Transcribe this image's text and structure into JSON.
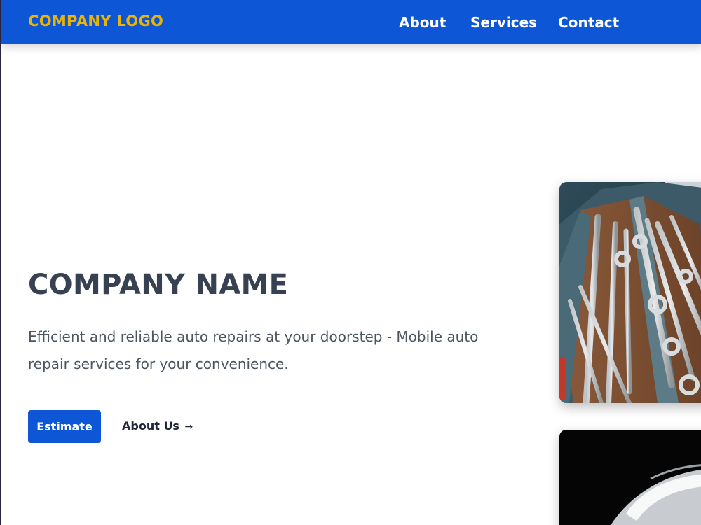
{
  "header": {
    "logo_text": "COMPANY LOGO",
    "nav": {
      "about": "About",
      "services": "Services",
      "contact": "Contact"
    }
  },
  "hero": {
    "title": "COMPANY NAME",
    "subtitle": "Efficient and reliable auto repairs at your doorstep - Mobile auto repair services for your convenience.",
    "primary_button": "Estimate",
    "secondary_link": "About Us",
    "secondary_link_arrow": "→"
  },
  "images": {
    "tools": "tool drawer with wrenches",
    "car": "car in the dark"
  },
  "colors": {
    "brand_blue": "#0d56d6",
    "logo_yellow": "#eab308",
    "title_gray": "#374151",
    "text_gray": "#4b5563"
  }
}
